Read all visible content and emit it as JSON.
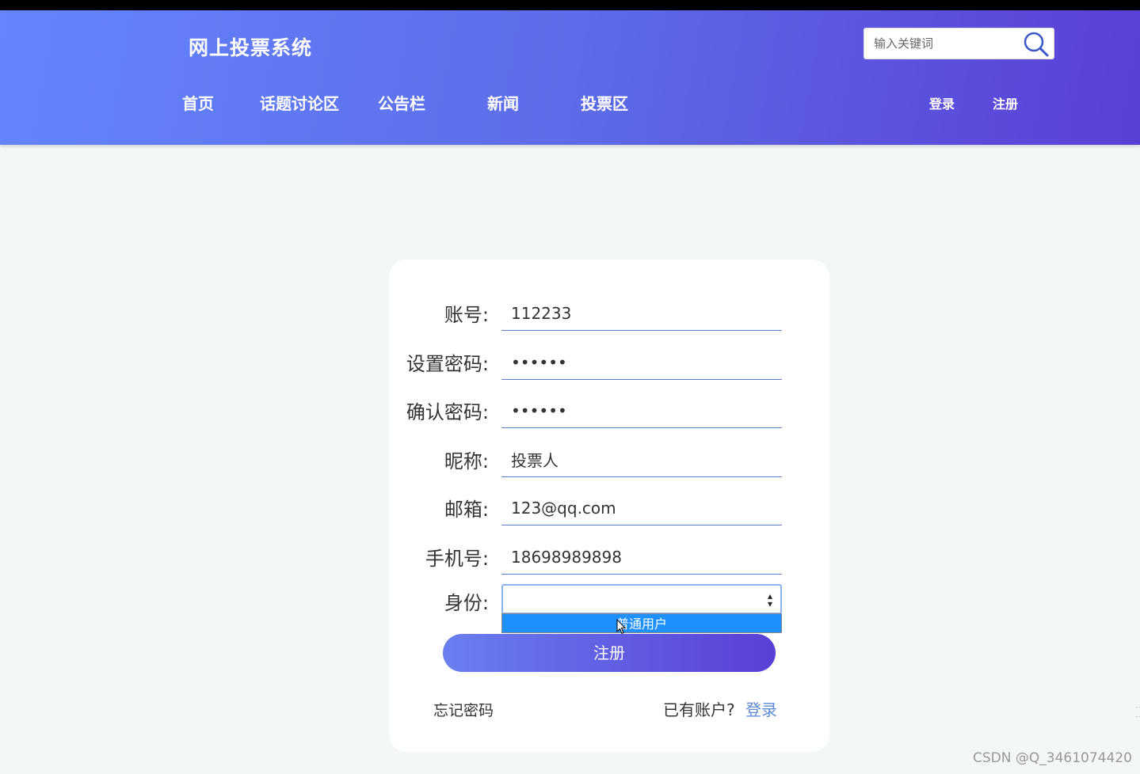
{
  "header": {
    "site_title": "网上投票系统",
    "nav": [
      "首页",
      "话题讨论区",
      "公告栏",
      "新闻",
      "投票区"
    ],
    "auth": {
      "login": "登录",
      "register": "注册"
    },
    "search": {
      "placeholder": "输入关键词"
    }
  },
  "form": {
    "fields": [
      {
        "label": "账号:",
        "value": "112233"
      },
      {
        "label": "设置密码:",
        "value": "••••••"
      },
      {
        "label": "确认密码:",
        "value": "••••••"
      },
      {
        "label": "昵称:",
        "value": "投票人"
      },
      {
        "label": "邮箱:",
        "value": "123@qq.com"
      },
      {
        "label": "手机号:",
        "value": "18698989898"
      }
    ],
    "identity": {
      "label": "身份:",
      "value": "",
      "options": [
        "普通用户"
      ]
    },
    "submit_label": "注册",
    "forgot_label": "忘记密码",
    "have_account_label": "已有账户?",
    "login_label": "登录"
  },
  "watermark": "CSDN @Q_3461074420",
  "colors": {
    "header_start": "#6485fc",
    "header_end": "#5a3fd6",
    "option_highlight": "#1e90ff",
    "link": "#5a8ad8"
  }
}
